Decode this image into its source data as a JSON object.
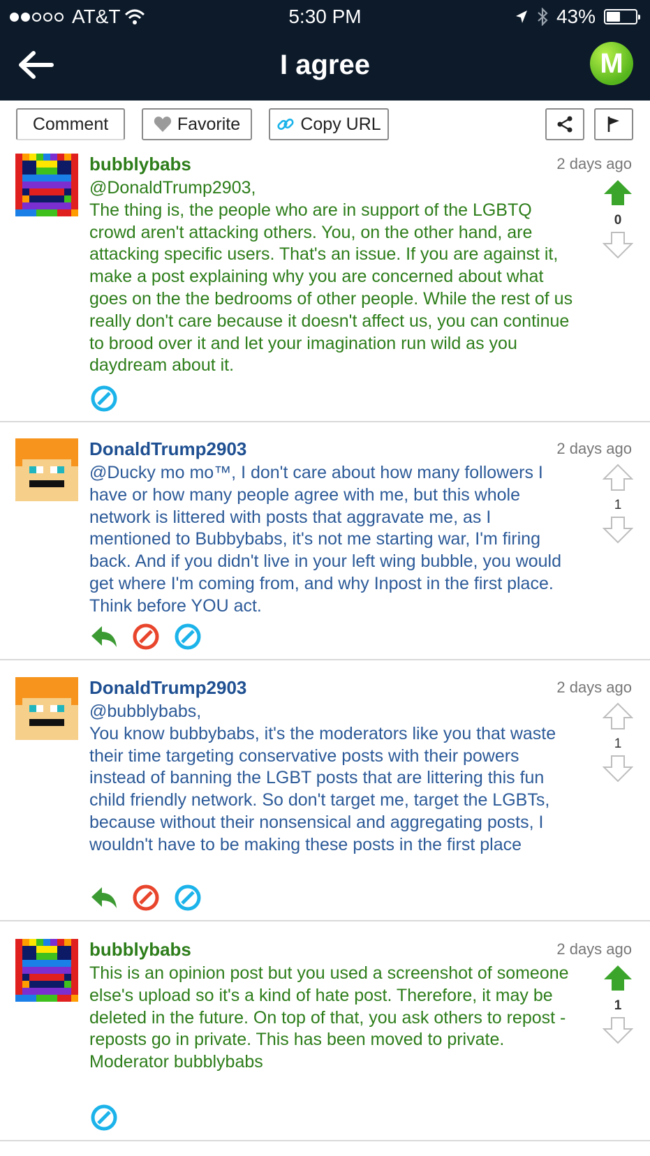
{
  "status_bar": {
    "carrier": "AT&T",
    "time": "5:30 PM",
    "battery": "43%"
  },
  "header": {
    "title": "I agree",
    "logo_letter": "M"
  },
  "toolbar": {
    "comment_label": "Comment",
    "favorite_label": "Favorite",
    "copy_url_label": "Copy URL"
  },
  "comments": [
    {
      "username": "bubblybabs",
      "time": "2 days ago",
      "votes": "0",
      "upvoted": true,
      "text": "@DonaldTrump2903,\nThe thing is, the people who are in support of the LGBTQ crowd aren't attacking others. You, on the other hand, are attacking specific users. That's an issue. If you are against it, make a post explaining why you are concerned about what goes on the the bedrooms of other people. While the rest of us really don't care because it doesn't affect us, you can continue to brood over it and let your imagination run wild as you daydream about it."
    },
    {
      "username": "DonaldTrump2903",
      "time": "2 days ago",
      "votes": "1",
      "upvoted": false,
      "text": "@Ducky mo mo™, I don't care about how many followers I have or how many people agree with me, but this whole network is littered with posts that aggravate me, as I mentioned to Bubbybabs, it's not me starting war, I'm firing back. And if you didn't live in your left wing bubble, you would get where I'm coming from, and why Inpost in the first place. Think before YOU act."
    },
    {
      "username": "DonaldTrump2903",
      "time": "2 days ago",
      "votes": "1",
      "upvoted": false,
      "text": "@bubblybabs,\nYou know bubbybabs, it's the moderators like you that waste their time targeting conservative posts with their powers instead of banning the LGBT posts that are littering this fun child friendly network. So don't target me, target the LGBTs, because without their nonsensical and aggregating posts, I wouldn't have to be making these posts in the first place"
    },
    {
      "username": "bubblybabs",
      "time": "2 days ago",
      "votes": "1",
      "upvoted": true,
      "text": "This is an opinion post but you used a screenshot of someone else's upload so it's a kind of hate post. Therefore, it may be deleted in the future. On top of that, you ask others to repost - reposts go in private. This has been moved to private.\nModerator bubblybabs"
    }
  ],
  "colors": {
    "header_bg": "#0c1a2a",
    "green_text": "#2d7d1a",
    "blue_text": "#2c5a98",
    "upvote_green": "#3aa52a",
    "reply_green": "#3c9a33",
    "block_red": "#e8452c",
    "hide_blue": "#1bb3ea"
  }
}
